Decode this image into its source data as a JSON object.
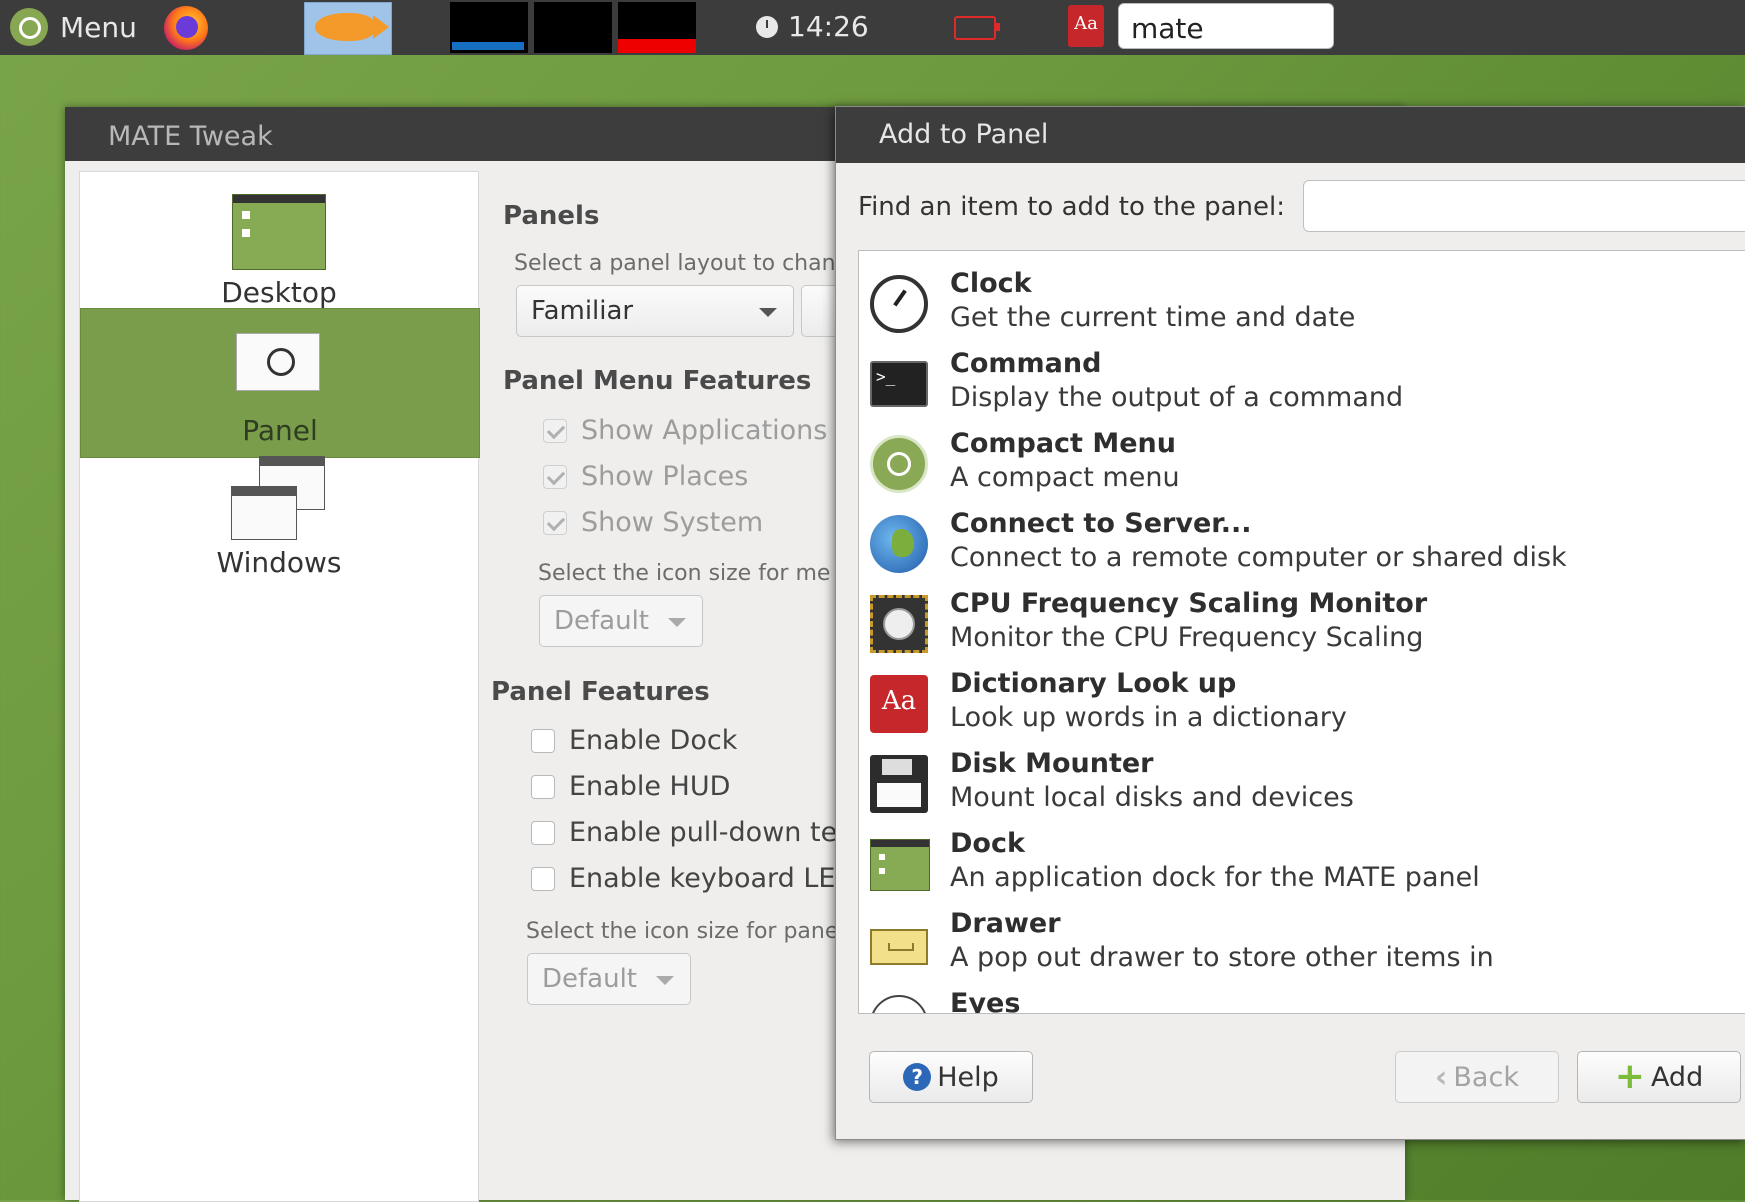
{
  "top_panel": {
    "menu_label": "Menu",
    "clock": "14:26",
    "search_value": "mate"
  },
  "tweak": {
    "title": "MATE Tweak",
    "sidebar": [
      {
        "label": "Desktop",
        "icon": "desktop-icon"
      },
      {
        "label": "Panel",
        "icon": "panel-icon",
        "active": true
      },
      {
        "label": "Windows",
        "icon": "windows-icon"
      }
    ],
    "panels_heading": "Panels",
    "layout_prompt": "Select a panel layout to chang",
    "layout_value": "Familiar",
    "menu_features_heading": "Panel Menu Features",
    "menu_features": [
      {
        "label": "Show Applications",
        "checked": true
      },
      {
        "label": "Show Places",
        "checked": true
      },
      {
        "label": "Show System",
        "checked": true
      }
    ],
    "menu_icon_prompt": "Select the icon size for me",
    "menu_icon_value": "Default",
    "panel_features_heading": "Panel Features",
    "panel_features": [
      {
        "label": "Enable Dock",
        "checked": false
      },
      {
        "label": "Enable HUD",
        "checked": false
      },
      {
        "label": "Enable pull-down te",
        "checked": false
      },
      {
        "label": "Enable keyboard LE",
        "checked": false
      }
    ],
    "panel_icon_prompt": "Select the icon size for pane",
    "panel_icon_value": "Default"
  },
  "dialog": {
    "title": "Add to Panel",
    "find_label": "Find an item to add to the panel:",
    "find_value": "",
    "items": [
      {
        "name": "Clock",
        "desc": "Get the current time and date",
        "icon": "clock-icon"
      },
      {
        "name": "Command",
        "desc": "Display the output of a command",
        "icon": "terminal-icon"
      },
      {
        "name": "Compact Menu",
        "desc": "A compact menu",
        "icon": "compact-menu-icon"
      },
      {
        "name": "Connect to Server...",
        "desc": "Connect to a remote computer or shared disk",
        "icon": "globe-icon"
      },
      {
        "name": "CPU Frequency Scaling Monitor",
        "desc": "Monitor the CPU Frequency Scaling",
        "icon": "cpu-icon"
      },
      {
        "name": "Dictionary Look up",
        "desc": "Look up words in a dictionary",
        "icon": "dictionary-icon"
      },
      {
        "name": "Disk Mounter",
        "desc": "Mount local disks and devices",
        "icon": "floppy-icon"
      },
      {
        "name": "Dock",
        "desc": "An application dock for the MATE panel",
        "icon": "dock-icon"
      },
      {
        "name": "Drawer",
        "desc": "A pop out drawer to store other items in",
        "icon": "drawer-icon"
      },
      {
        "name": "Eyes",
        "desc": "",
        "icon": "eyes-icon"
      }
    ],
    "help_label": "Help",
    "back_label": "Back",
    "add_label": "Add",
    "dict_icon_text": "Aa"
  }
}
